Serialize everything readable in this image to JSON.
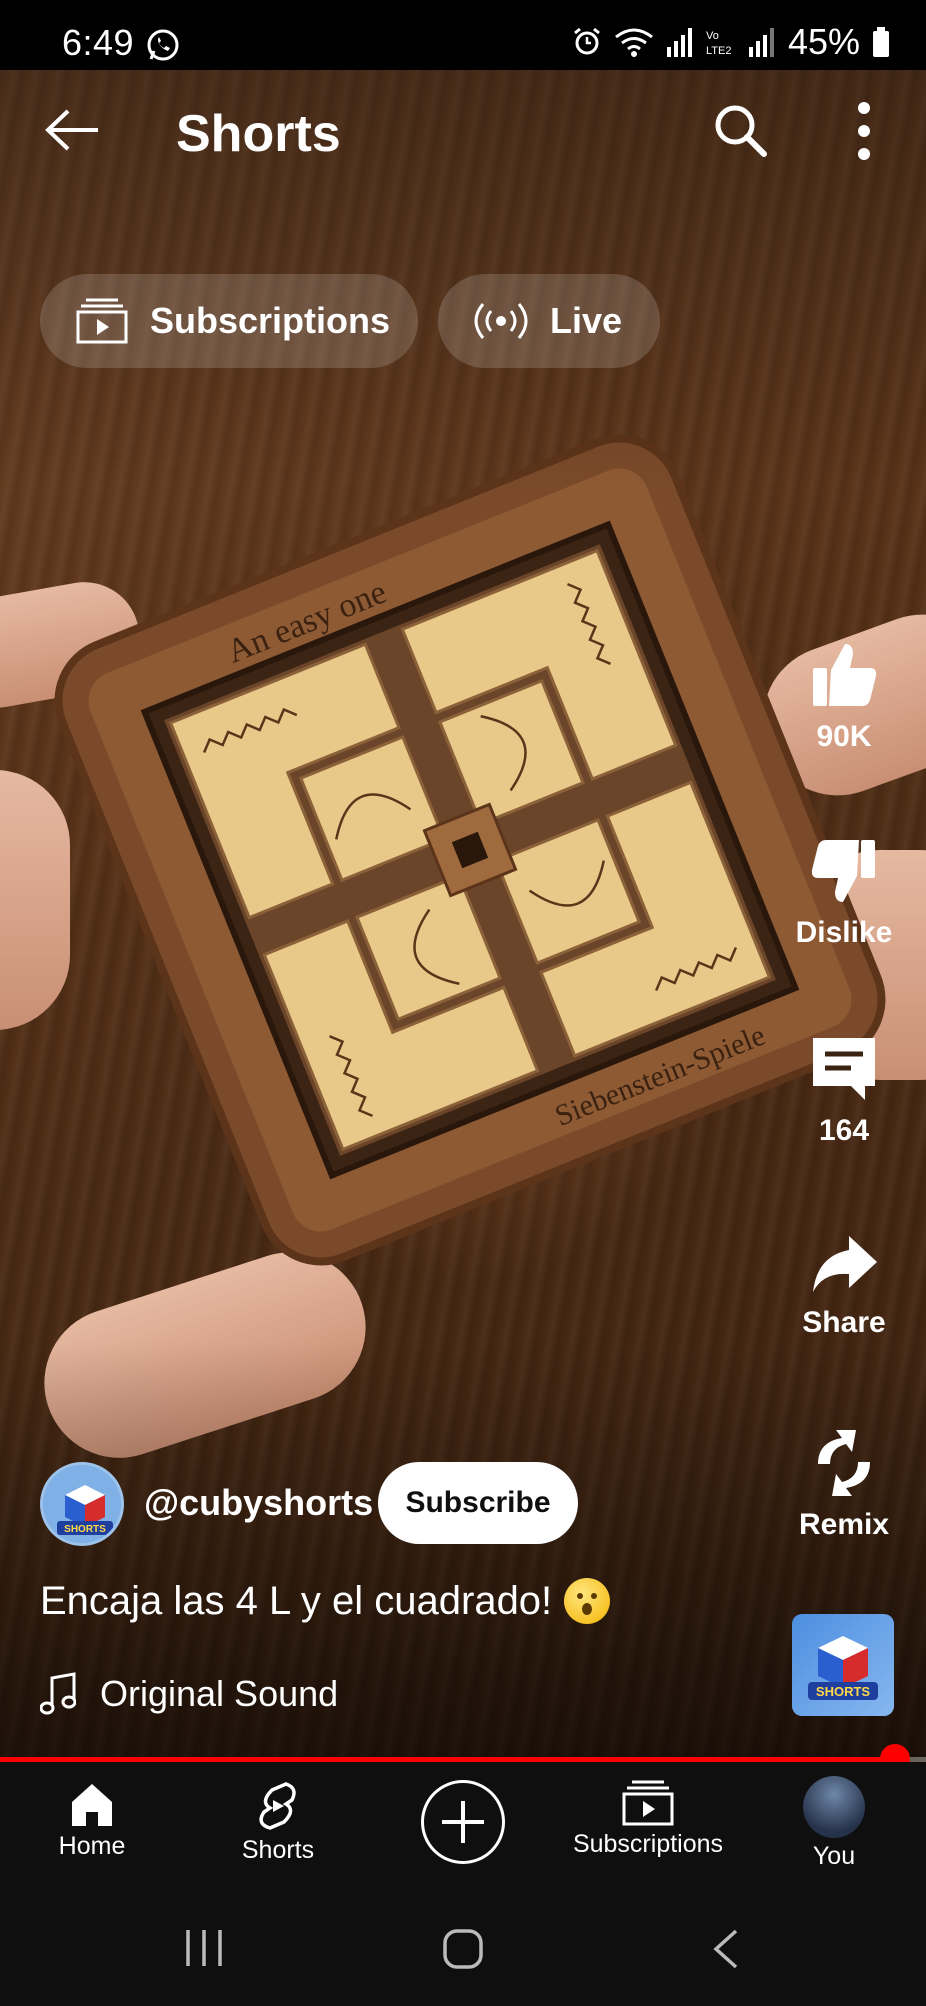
{
  "status_bar": {
    "time": "6:49",
    "battery": "45%",
    "icons": [
      "whatsapp-icon",
      "alarm-icon",
      "wifi-icon",
      "signal-icon",
      "volte-icon",
      "signal-icon",
      "battery-icon"
    ]
  },
  "header": {
    "title": "Shorts",
    "icons": [
      "back-arrow-icon",
      "search-icon",
      "more-vert-icon"
    ]
  },
  "chips": [
    {
      "label": "Subscriptions",
      "icon": "subscriptions-icon"
    },
    {
      "label": "Live",
      "icon": "live-broadcast-icon"
    }
  ],
  "video": {
    "overlay_text_top": "An easy one",
    "overlay_text_bottom": "Siebenstein-Spiele"
  },
  "actions": {
    "like_count": "90K",
    "dislike_label": "Dislike",
    "comment_count": "164",
    "share_label": "Share",
    "remix_label": "Remix"
  },
  "channel": {
    "handle": "@cubyshorts",
    "subscribe_label": "Subscribe",
    "avatar_text": "SHORTS"
  },
  "caption": "Encaja las 4 L y el cuadrado!",
  "sound": {
    "label": "Original Sound",
    "thumb_text": "SHORTS"
  },
  "progress": {
    "fraction": 0.966
  },
  "bottom_nav": [
    {
      "label": "Home",
      "icon": "home-icon"
    },
    {
      "label": "Shorts",
      "icon": "shorts-icon"
    },
    {
      "label": "",
      "icon": "create-plus-icon"
    },
    {
      "label": "Subscriptions",
      "icon": "subscriptions-icon"
    },
    {
      "label": "You",
      "icon": "avatar-icon"
    }
  ],
  "system_nav": [
    "recents-icon",
    "home-circle-icon",
    "back-chevron-icon"
  ],
  "colors": {
    "accent": "#ff0000",
    "nav_bg": "#0f0f0f",
    "chip_bg": "rgba(255,255,255,0.16)",
    "wood": "#5a3419",
    "puzzle_tile": "#e9c98a"
  }
}
